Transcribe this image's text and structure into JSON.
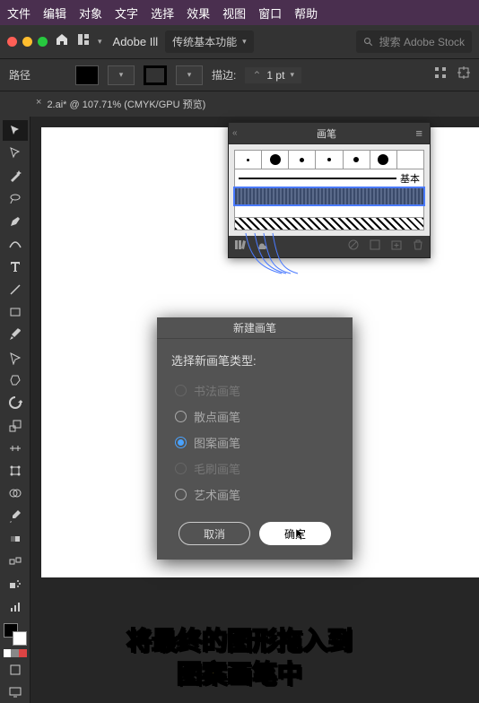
{
  "menubar": [
    "文件",
    "编辑",
    "对象",
    "文字",
    "选择",
    "效果",
    "视图",
    "窗口",
    "帮助"
  ],
  "ctrlbar": {
    "app": "Adobe Ill",
    "workspace": "传统基本功能",
    "search_placeholder": "搜索 Adobe Stock"
  },
  "propbar": {
    "path_label": "路径",
    "stroke_label": "描边:",
    "stroke_value": "1 pt"
  },
  "document_tab": "2.ai* @ 107.71% (CMYK/GPU 预览)",
  "brushes_panel": {
    "title": "画笔",
    "basic_label": "基本"
  },
  "dialog": {
    "title": "新建画笔",
    "prompt": "选择新画笔类型:",
    "options": [
      {
        "label": "书法画笔",
        "enabled": false,
        "checked": false
      },
      {
        "label": "散点画笔",
        "enabled": true,
        "checked": false
      },
      {
        "label": "图案画笔",
        "enabled": true,
        "checked": true
      },
      {
        "label": "毛刷画笔",
        "enabled": false,
        "checked": false
      },
      {
        "label": "艺术画笔",
        "enabled": true,
        "checked": false
      }
    ],
    "cancel": "取消",
    "ok": "确定"
  },
  "caption": {
    "line1": "将最终的图形拖入到",
    "line2": "图案画笔中"
  }
}
